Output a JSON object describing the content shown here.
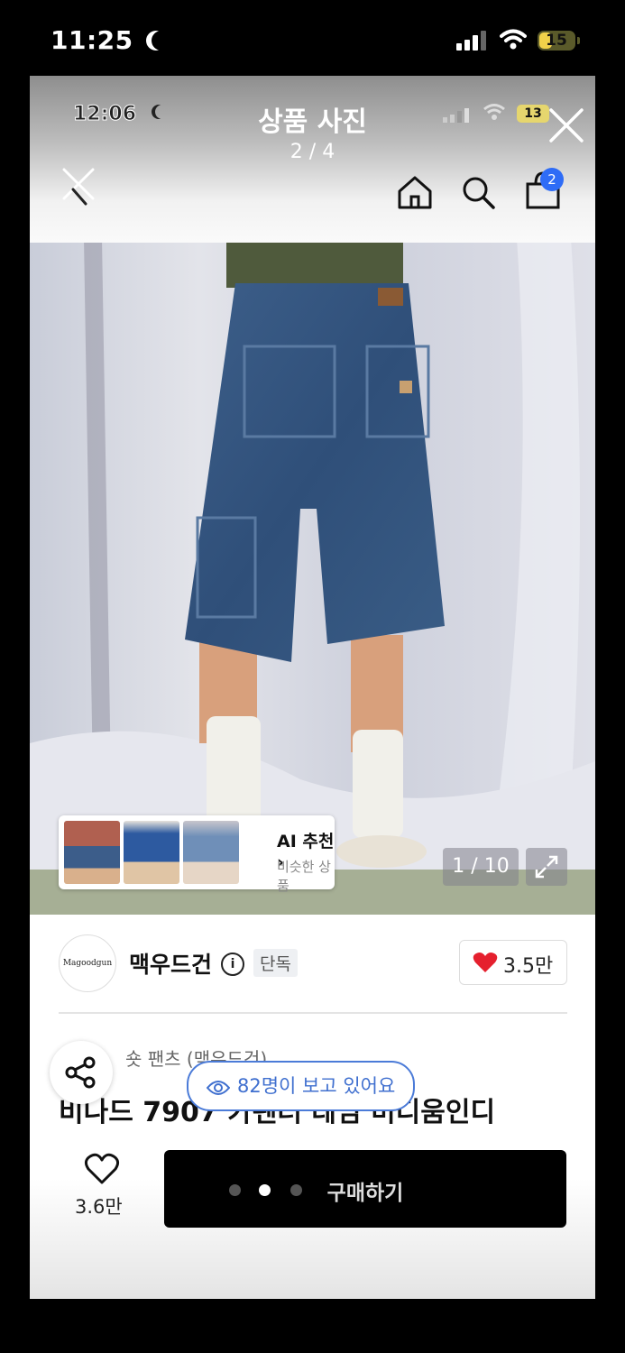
{
  "os_status": {
    "time": "11:25",
    "battery": "15"
  },
  "inner_status": {
    "time": "12:06",
    "battery": "13"
  },
  "viewer": {
    "title": "상품 사진",
    "counter": "2 / 4"
  },
  "header": {
    "cart_count": "2"
  },
  "gallery": {
    "photo_count": "1 / 10"
  },
  "recommend": {
    "title": "AI 추천",
    "subtitle": "비슷한 상품"
  },
  "brand": {
    "logo_text": "Magoodgun",
    "name": "맥우드건",
    "exclusive": "단독",
    "likes": "3.5만"
  },
  "product": {
    "category": "숏 팬츠 (맥우드건)",
    "title": "비나드 7907 카펜터 데님 미디움인디"
  },
  "live": {
    "viewers": "82명이 보고 있어요"
  },
  "bottom": {
    "wish_count": "3.6만",
    "buy_label": "구매하기"
  },
  "colors": {
    "accent_blue": "#2e6cf6",
    "heart_red": "#e5202e",
    "buy_bg": "#000000"
  },
  "icons": [
    "moon-icon",
    "signal-icon",
    "wifi-icon",
    "battery-icon",
    "close-icon",
    "home-icon",
    "search-icon",
    "cart-icon",
    "info-icon",
    "heart-icon",
    "share-icon",
    "eye-icon",
    "expand-icon",
    "chevron-right-icon"
  ]
}
